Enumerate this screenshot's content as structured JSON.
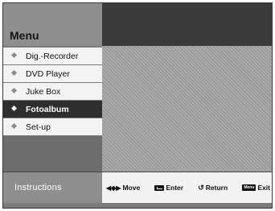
{
  "menu": {
    "title": "Menu",
    "items": [
      {
        "label": "Dig.-Recorder",
        "selected": false
      },
      {
        "label": "DVD Player",
        "selected": false
      },
      {
        "label": "Juke Box",
        "selected": false
      },
      {
        "label": "Fotoalbum",
        "selected": true
      },
      {
        "label": "Set-up",
        "selected": false
      }
    ]
  },
  "instructions": {
    "label": "Instructions",
    "hints": [
      {
        "icon": "arrows-icon",
        "glyph": "◀◆▶",
        "label": "Move"
      },
      {
        "icon": "enter-key-icon",
        "glyph": "",
        "label": "Enter"
      },
      {
        "icon": "return-icon",
        "glyph": "↺",
        "label": "Return"
      },
      {
        "icon": "menu-key-icon",
        "glyph": "Menu",
        "label": "Exit"
      }
    ]
  },
  "colors": {
    "background": "#7c7c7c",
    "header_dark": "#3a3a3a",
    "selected": "#2e2e2e",
    "item": "#f3f3f3",
    "instructions_bar": "#f2f2f2"
  }
}
